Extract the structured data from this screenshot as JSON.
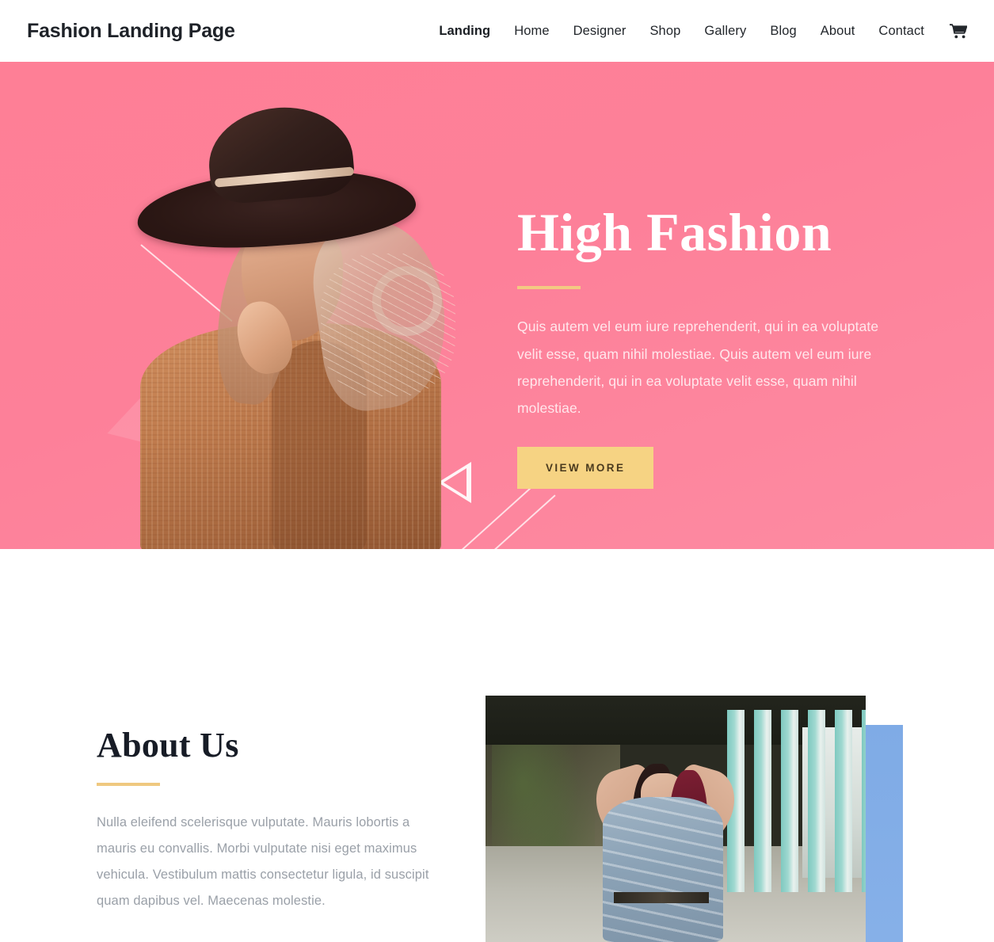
{
  "header": {
    "brand": "Fashion Landing Page",
    "nav": [
      {
        "label": "Landing",
        "active": true
      },
      {
        "label": "Home",
        "active": false
      },
      {
        "label": "Designer",
        "active": false
      },
      {
        "label": "Shop",
        "active": false
      },
      {
        "label": "Gallery",
        "active": false
      },
      {
        "label": "Blog",
        "active": false
      },
      {
        "label": "About",
        "active": false
      },
      {
        "label": "Contact",
        "active": false
      }
    ],
    "cart_icon": "shopping-cart-icon"
  },
  "hero": {
    "title": "High Fashion",
    "paragraph": "Quis autem vel eum iure reprehenderit, qui in ea voluptate velit esse, quam nihil molestiae. Quis autem vel eum iure reprehenderit, qui in ea voluptate velit esse, quam nihil molestiae.",
    "button_label": "VIEW MORE",
    "background_color": "#fd879e",
    "accent_color": "#f3c982",
    "button_color": "#f6d383",
    "image_alt": "Woman wearing wide-brim dark hat and rust knit sweater",
    "decorations": [
      "circle-outline",
      "triangle-outline-small",
      "triangle-outline-large",
      "diagonal-lines"
    ]
  },
  "about": {
    "title": "About Us",
    "paragraph": "Nulla eleifend scelerisque vulputate. Mauris lobortis a mauris eu convallis. Morbi vulputate nisi eget maximus vehicula. Vestibulum mattis consectetur ligula, id suscipit quam dapibus vel. Maecenas molestie.",
    "accent_color": "#efc880",
    "blue_panel_color": "#7fabe6",
    "image_alt": "Woman with burgundy hair in blue patterned dress in a columned corridor"
  }
}
